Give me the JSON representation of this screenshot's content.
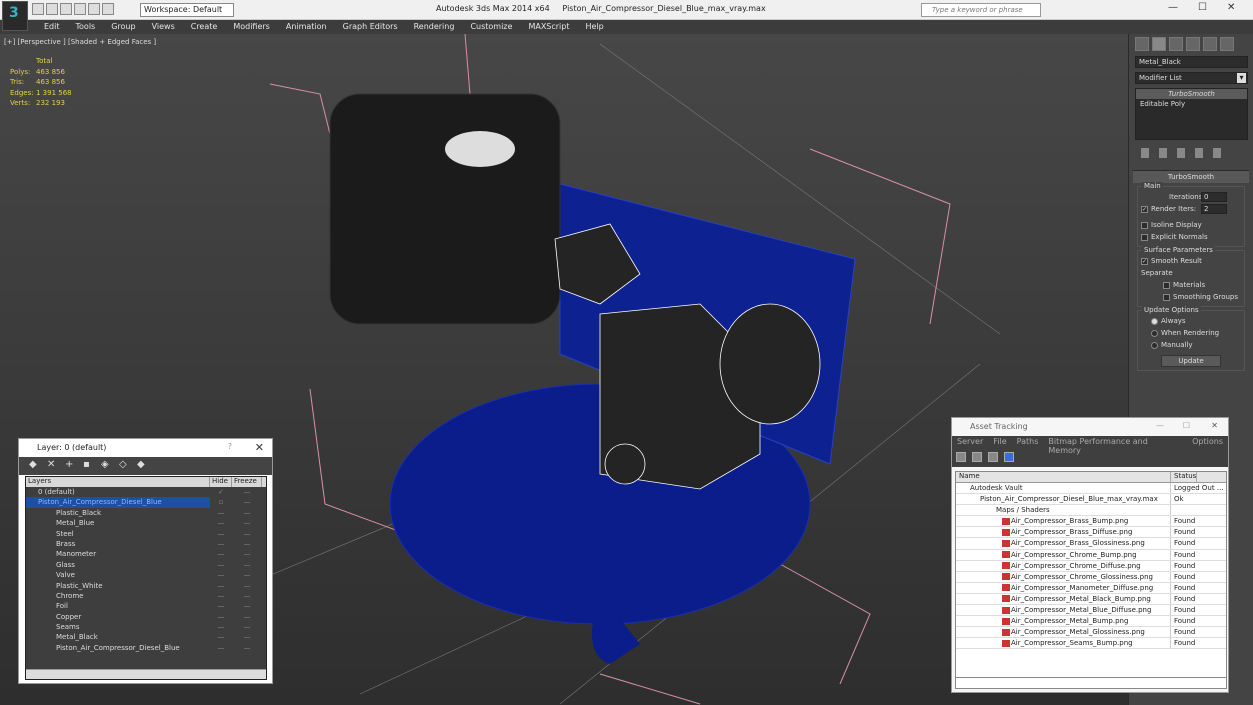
{
  "app": {
    "title": "Autodesk 3ds Max  2014 x64",
    "file": "Piston_Air_Compressor_Diesel_Blue_max_vray.max",
    "workspace": "Workspace: Default",
    "search_placeholder": "Type a keyword or phrase"
  },
  "menu": [
    "Edit",
    "Tools",
    "Group",
    "Views",
    "Create",
    "Modifiers",
    "Animation",
    "Graph Editors",
    "Rendering",
    "Customize",
    "MAXScript",
    "Help"
  ],
  "viewport": {
    "label": "[+] [Perspective ] [Shaded + Edged Faces ]",
    "stats_header": "Total",
    "stats": [
      {
        "k": "Polys:",
        "v": "463 856"
      },
      {
        "k": "Tris:",
        "v": "463 856"
      },
      {
        "k": "Edges:",
        "v": "1 391 568"
      },
      {
        "k": "Verts:",
        "v": "232 193"
      }
    ]
  },
  "modifier_panel": {
    "object_name": "Metal_Black",
    "modifier_list": "Modifier List",
    "stack": [
      "TurboSmooth",
      "Editable Poly"
    ],
    "rollout": "TurboSmooth",
    "main": {
      "label": "Main",
      "iterations_label": "Iterations:",
      "iterations": "0",
      "render_iters_label": "Render Iters:",
      "render_iters": "2",
      "isoline": "Isoline Display",
      "explicit": "Explicit Normals"
    },
    "surface": {
      "label": "Surface Parameters",
      "smooth_result": "Smooth Result",
      "separate": "Separate",
      "materials": "Materials",
      "smoothing_groups": "Smoothing Groups"
    },
    "update": {
      "label": "Update Options",
      "always": "Always",
      "when_rendering": "When Rendering",
      "manually": "Manually",
      "button": "Update"
    }
  },
  "layer_window": {
    "title": "Layer: 0 (default)",
    "col_layers": "Layers",
    "col_hide": "Hide",
    "col_freeze": "Freeze",
    "rows": [
      "0 (default)",
      "Piston_Air_Compressor_Diesel_Blue",
      "Plastic_Black",
      "Metal_Blue",
      "Steel",
      "Brass",
      "Manometer",
      "Glass",
      "Valve",
      "Plastic_White",
      "Chrome",
      "Foil",
      "Copper",
      "Seams",
      "Metal_Black",
      "Piston_Air_Compressor_Diesel_Blue"
    ]
  },
  "asset_window": {
    "title": "Asset Tracking",
    "menu": [
      "Server",
      "File",
      "Paths",
      "Bitmap Performance and Memory",
      "Options"
    ],
    "col_name": "Name",
    "col_status": "Status",
    "rows": [
      {
        "name": "Autodesk Vault",
        "status": "Logged Out ..."
      },
      {
        "name": "Piston_Air_Compressor_Diesel_Blue_max_vray.max",
        "status": "Ok"
      },
      {
        "name": "Maps / Shaders",
        "status": ""
      },
      {
        "name": "Air_Compressor_Brass_Bump.png",
        "status": "Found"
      },
      {
        "name": "Air_Compressor_Brass_Diffuse.png",
        "status": "Found"
      },
      {
        "name": "Air_Compressor_Brass_Glossiness.png",
        "status": "Found"
      },
      {
        "name": "Air_Compressor_Chrome_Bump.png",
        "status": "Found"
      },
      {
        "name": "Air_Compressor_Chrome_Diffuse.png",
        "status": "Found"
      },
      {
        "name": "Air_Compressor_Chrome_Glossiness.png",
        "status": "Found"
      },
      {
        "name": "Air_Compressor_Manometer_Diffuse.png",
        "status": "Found"
      },
      {
        "name": "Air_Compressor_Metal_Black_Bump.png",
        "status": "Found"
      },
      {
        "name": "Air_Compressor_Metal_Blue_Diffuse.png",
        "status": "Found"
      },
      {
        "name": "Air_Compressor_Metal_Bump.png",
        "status": "Found"
      },
      {
        "name": "Air_Compressor_Metal_Glossiness.png",
        "status": "Found"
      },
      {
        "name": "Air_Compressor_Seams_Bump.png",
        "status": "Found"
      }
    ]
  }
}
